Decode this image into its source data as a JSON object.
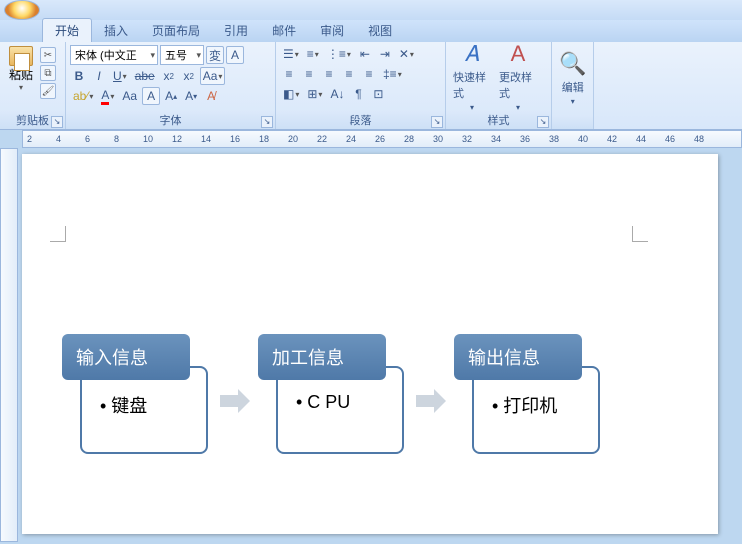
{
  "tabs": [
    "开始",
    "插入",
    "页面布局",
    "引用",
    "邮件",
    "审阅",
    "视图"
  ],
  "active_tab": 0,
  "clipboard": {
    "paste": "粘贴",
    "label": "剪贴板"
  },
  "font": {
    "family": "宋体 (中文正",
    "size": "五号",
    "label": "字体"
  },
  "paragraph": {
    "label": "段落"
  },
  "styles": {
    "quick": "快速样式",
    "change": "更改样式",
    "label": "样式"
  },
  "edit": {
    "label": "编辑"
  },
  "ruler": [
    2,
    4,
    6,
    8,
    10,
    12,
    14,
    16,
    18,
    20,
    22,
    24,
    26,
    28,
    30,
    32,
    34,
    36,
    38,
    40,
    42,
    44,
    46,
    48
  ],
  "smartart": [
    {
      "title": "输入信息",
      "bullet": "键盘"
    },
    {
      "title": "加工信息",
      "bullet": "C PU"
    },
    {
      "title": "输出信息",
      "bullet": "打印机"
    }
  ]
}
